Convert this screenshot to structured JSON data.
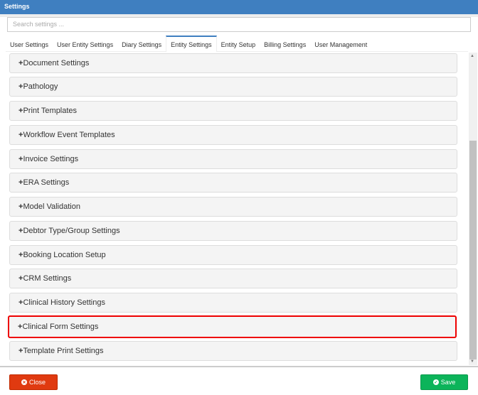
{
  "window": {
    "title": "Settings"
  },
  "search": {
    "placeholder": "Search settings ..."
  },
  "tabs": [
    {
      "label": "User Settings"
    },
    {
      "label": "User Entity Settings"
    },
    {
      "label": "Diary Settings"
    },
    {
      "label": "Entity Settings",
      "active": true
    },
    {
      "label": "Entity Setup"
    },
    {
      "label": "Billing Settings"
    },
    {
      "label": "User Management"
    }
  ],
  "panels": [
    {
      "label": "Document Settings"
    },
    {
      "label": "Pathology"
    },
    {
      "label": "Print Templates"
    },
    {
      "label": "Workflow Event Templates"
    },
    {
      "label": "Invoice Settings"
    },
    {
      "label": "ERA Settings"
    },
    {
      "label": "Model Validation"
    },
    {
      "label": "Debtor Type/Group Settings"
    },
    {
      "label": "Booking Location Setup"
    },
    {
      "label": "CRM Settings"
    },
    {
      "label": "Clinical History Settings"
    },
    {
      "label": "Clinical Form Settings",
      "highlighted": true
    },
    {
      "label": "Template Print Settings"
    }
  ],
  "expand_symbol": "+",
  "footer": {
    "close_label": "Close",
    "save_label": "Save",
    "close_icon": "x-circle-icon",
    "save_icon": "check-circle-icon"
  },
  "colors": {
    "titlebar": "#3f7fc0",
    "close": "#e03a10",
    "save": "#0cb45a",
    "highlight": "#ee0000"
  }
}
